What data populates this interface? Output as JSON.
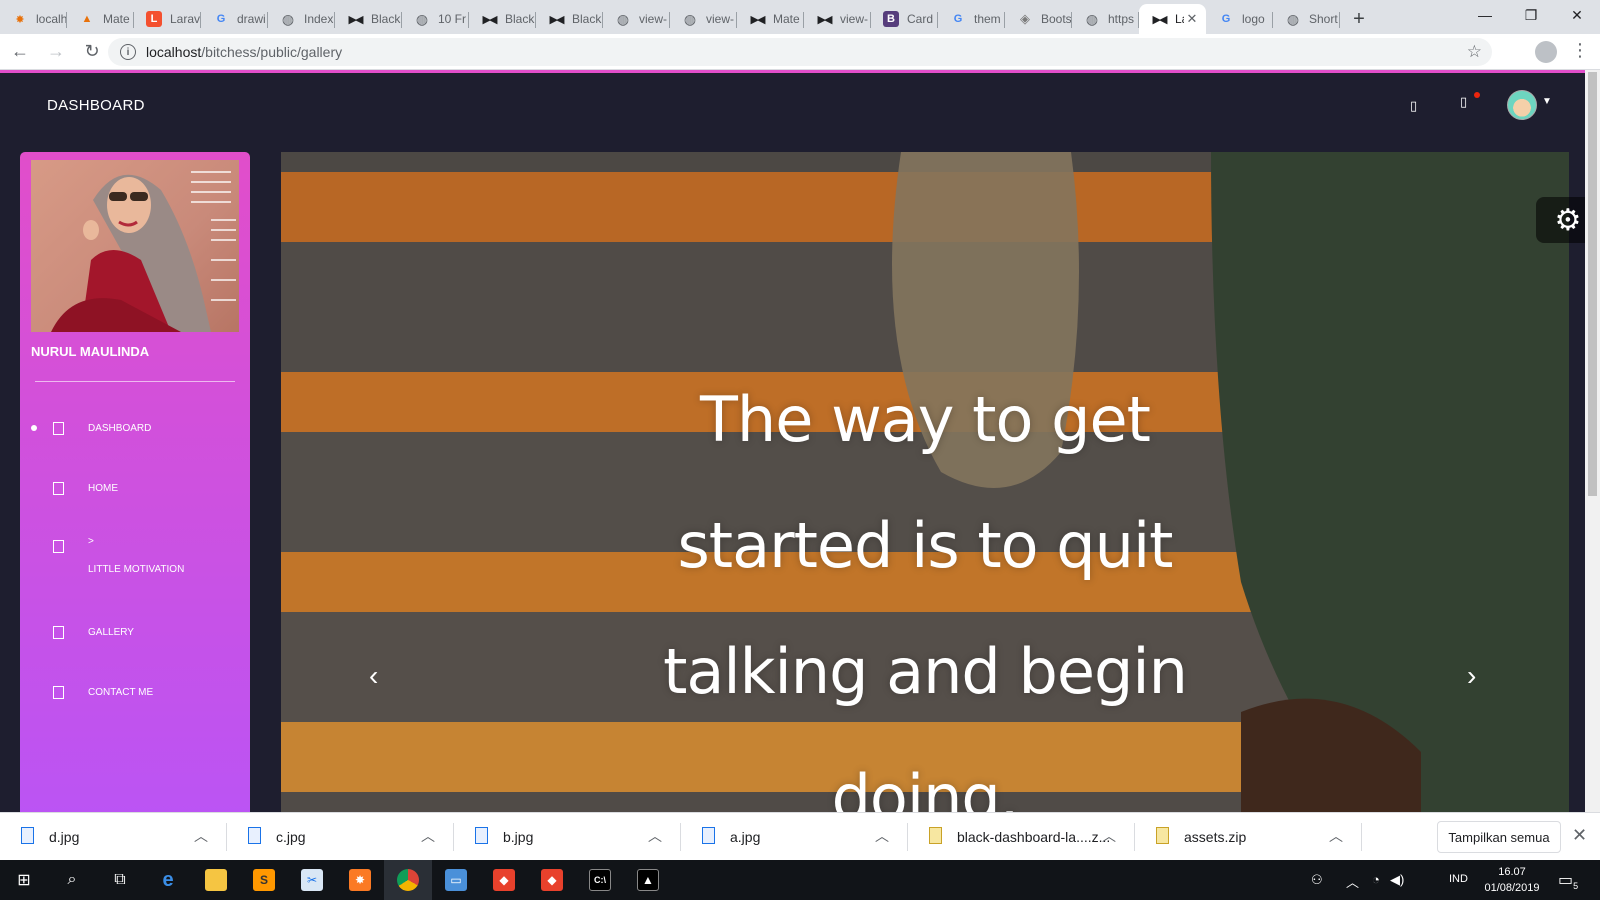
{
  "browser": {
    "tabs": [
      {
        "title": "localh",
        "icon": "xampp-icon"
      },
      {
        "title": "Mate",
        "icon": "angular-icon"
      },
      {
        "title": "Larav",
        "icon": "laravel-icon"
      },
      {
        "title": "drawi",
        "icon": "google-icon"
      },
      {
        "title": "Index",
        "icon": "globe-icon"
      },
      {
        "title": "Black",
        "icon": "bowtie-icon"
      },
      {
        "title": "10 Fr",
        "icon": "globe-icon"
      },
      {
        "title": "Black",
        "icon": "bowtie-icon"
      },
      {
        "title": "Black",
        "icon": "bowtie-icon"
      },
      {
        "title": "view-",
        "icon": "globe-icon"
      },
      {
        "title": "view-",
        "icon": "globe-icon"
      },
      {
        "title": "Mate",
        "icon": "bowtie-icon"
      },
      {
        "title": "view-",
        "icon": "bowtie-icon"
      },
      {
        "title": "Card",
        "icon": "bootstrap-icon"
      },
      {
        "title": "them",
        "icon": "google-icon"
      },
      {
        "title": "Boots",
        "icon": "box-icon"
      },
      {
        "title": "https",
        "icon": "globe-icon"
      },
      {
        "title": "La",
        "icon": "bowtie-icon",
        "active": true
      },
      {
        "title": "logo",
        "icon": "google-icon"
      },
      {
        "title": "Short",
        "icon": "globe-icon"
      }
    ],
    "new_tab": "+",
    "url_host": "localhost",
    "url_path": "/bitchess/public/gallery"
  },
  "navbar": {
    "brand": "DASHBOARD"
  },
  "sidebar": {
    "user_name": "NURUL MAULINDA",
    "items": [
      {
        "label": "DASHBOARD",
        "active": true
      },
      {
        "label": "HOME"
      },
      {
        "label": ">"
      },
      {
        "label": "LITTLE MOTIVATION"
      },
      {
        "label": "GALLERY"
      },
      {
        "label": "CONTACT ME"
      }
    ]
  },
  "carousel": {
    "quote_line1": "The way to get",
    "quote_line2": "started is to quit",
    "quote_line3": "talking and begin",
    "quote_line4": "doing.",
    "prev": "‹",
    "next": "›"
  },
  "downloads": {
    "files": [
      {
        "name": "d.jpg",
        "type": "image"
      },
      {
        "name": "c.jpg",
        "type": "image"
      },
      {
        "name": "b.jpg",
        "type": "image"
      },
      {
        "name": "a.jpg",
        "type": "image"
      },
      {
        "name": "black-dashboard-la....z...",
        "type": "zip"
      },
      {
        "name": "assets.zip",
        "type": "zip"
      }
    ],
    "show_all": "Tampilkan semua"
  },
  "taskbar": {
    "lang": "IND",
    "time": "16.07",
    "date": "01/08/2019",
    "notifications": "5"
  },
  "colors": {
    "accent_pink": "#e14eca",
    "accent_purple": "#ba54f5",
    "page_bg": "#1e1e2f"
  }
}
